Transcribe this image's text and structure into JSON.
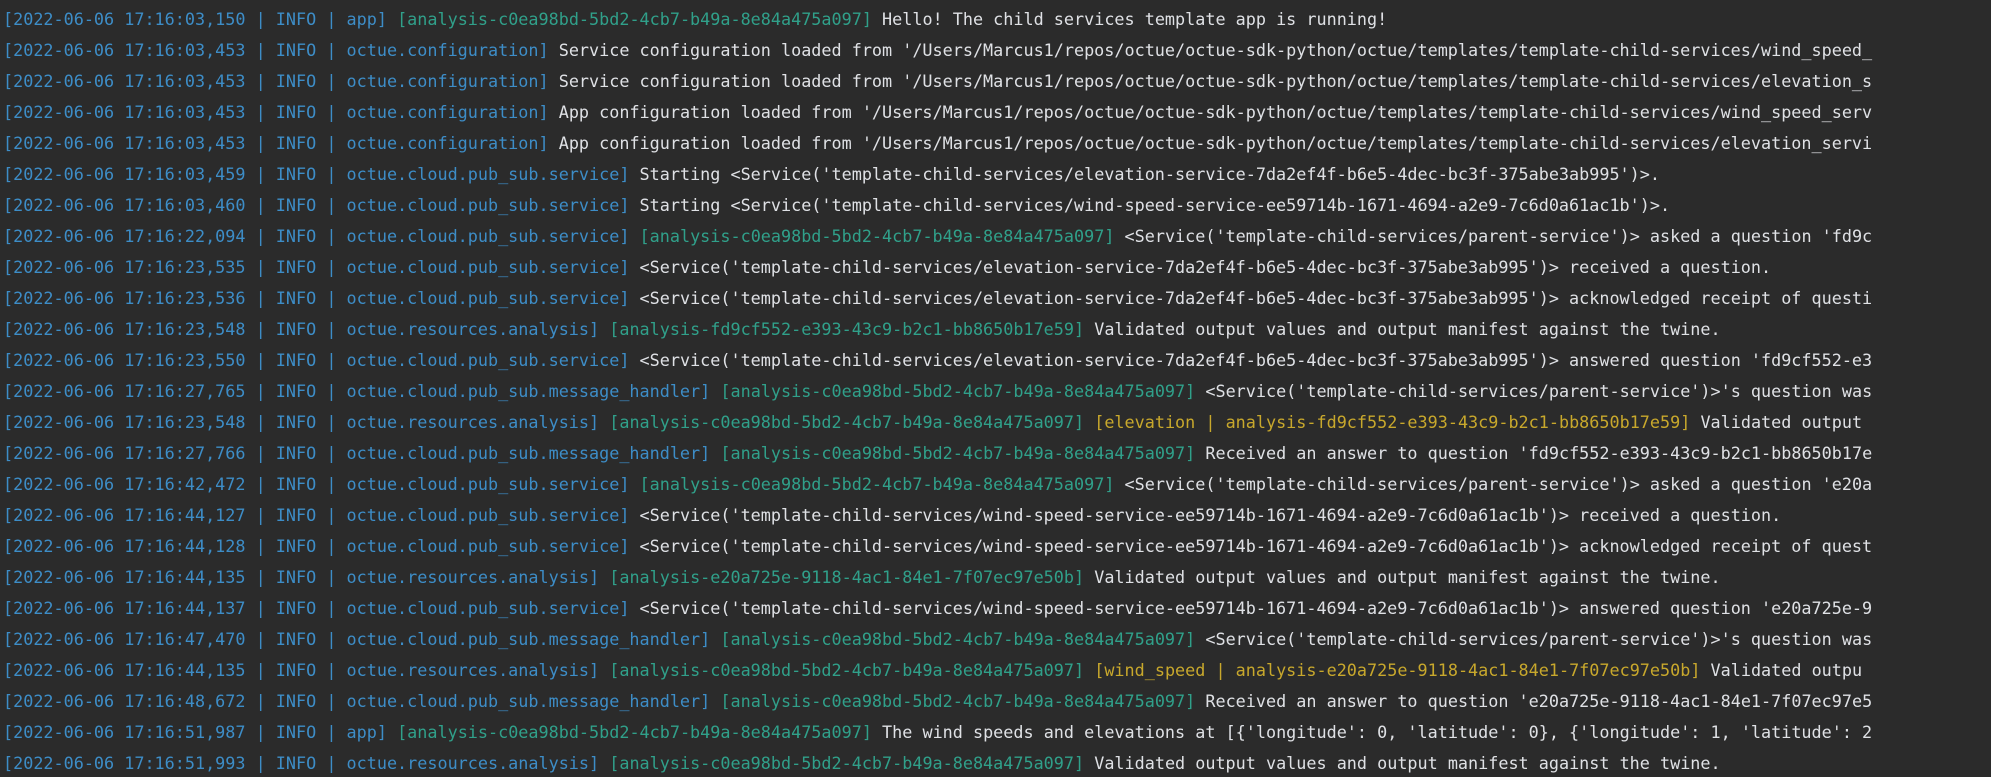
{
  "colors": {
    "background": "#2b2b2b",
    "timestamp_level_logger": "#3d8dc7",
    "analysis_tag": "#30a08a",
    "child_tag": "#c8a82c",
    "message": "#dfe1e5"
  },
  "lines": [
    {
      "ts": "2022-06-06 17:16:03,150",
      "level": "INFO",
      "logger": "app",
      "analysis": "analysis-c0ea98bd-5bd2-4cb7-b49a-8e84a475a097",
      "child": "",
      "message": "Hello! The child services template app is running!"
    },
    {
      "ts": "2022-06-06 17:16:03,453",
      "level": "INFO",
      "logger": "octue.configuration",
      "analysis": "",
      "child": "",
      "message": "Service configuration loaded from '/Users/Marcus1/repos/octue/octue-sdk-python/octue/templates/template-child-services/wind_speed_"
    },
    {
      "ts": "2022-06-06 17:16:03,453",
      "level": "INFO",
      "logger": "octue.configuration",
      "analysis": "",
      "child": "",
      "message": "Service configuration loaded from '/Users/Marcus1/repos/octue/octue-sdk-python/octue/templates/template-child-services/elevation_s"
    },
    {
      "ts": "2022-06-06 17:16:03,453",
      "level": "INFO",
      "logger": "octue.configuration",
      "analysis": "",
      "child": "",
      "message": "App configuration loaded from '/Users/Marcus1/repos/octue/octue-sdk-python/octue/templates/template-child-services/wind_speed_serv"
    },
    {
      "ts": "2022-06-06 17:16:03,453",
      "level": "INFO",
      "logger": "octue.configuration",
      "analysis": "",
      "child": "",
      "message": "App configuration loaded from '/Users/Marcus1/repos/octue/octue-sdk-python/octue/templates/template-child-services/elevation_servi"
    },
    {
      "ts": "2022-06-06 17:16:03,459",
      "level": "INFO",
      "logger": "octue.cloud.pub_sub.service",
      "analysis": "",
      "child": "",
      "message": "Starting <Service('template-child-services/elevation-service-7da2ef4f-b6e5-4dec-bc3f-375abe3ab995')>."
    },
    {
      "ts": "2022-06-06 17:16:03,460",
      "level": "INFO",
      "logger": "octue.cloud.pub_sub.service",
      "analysis": "",
      "child": "",
      "message": "Starting <Service('template-child-services/wind-speed-service-ee59714b-1671-4694-a2e9-7c6d0a61ac1b')>."
    },
    {
      "ts": "2022-06-06 17:16:22,094",
      "level": "INFO",
      "logger": "octue.cloud.pub_sub.service",
      "analysis": "analysis-c0ea98bd-5bd2-4cb7-b49a-8e84a475a097",
      "child": "",
      "message": "<Service('template-child-services/parent-service')> asked a question 'fd9c"
    },
    {
      "ts": "2022-06-06 17:16:23,535",
      "level": "INFO",
      "logger": "octue.cloud.pub_sub.service",
      "analysis": "",
      "child": "",
      "message": "<Service('template-child-services/elevation-service-7da2ef4f-b6e5-4dec-bc3f-375abe3ab995')> received a question."
    },
    {
      "ts": "2022-06-06 17:16:23,536",
      "level": "INFO",
      "logger": "octue.cloud.pub_sub.service",
      "analysis": "",
      "child": "",
      "message": "<Service('template-child-services/elevation-service-7da2ef4f-b6e5-4dec-bc3f-375abe3ab995')> acknowledged receipt of questi"
    },
    {
      "ts": "2022-06-06 17:16:23,548",
      "level": "INFO",
      "logger": "octue.resources.analysis",
      "analysis": "analysis-fd9cf552-e393-43c9-b2c1-bb8650b17e59",
      "child": "",
      "message": "Validated output values and output manifest against the twine."
    },
    {
      "ts": "2022-06-06 17:16:23,550",
      "level": "INFO",
      "logger": "octue.cloud.pub_sub.service",
      "analysis": "",
      "child": "",
      "message": "<Service('template-child-services/elevation-service-7da2ef4f-b6e5-4dec-bc3f-375abe3ab995')> answered question 'fd9cf552-e3"
    },
    {
      "ts": "2022-06-06 17:16:27,765",
      "level": "INFO",
      "logger": "octue.cloud.pub_sub.message_handler",
      "analysis": "analysis-c0ea98bd-5bd2-4cb7-b49a-8e84a475a097",
      "child": "",
      "message": "<Service('template-child-services/parent-service')>'s question was"
    },
    {
      "ts": "2022-06-06 17:16:23,548",
      "level": "INFO",
      "logger": "octue.resources.analysis",
      "analysis": "analysis-c0ea98bd-5bd2-4cb7-b49a-8e84a475a097",
      "child": "elevation | analysis-fd9cf552-e393-43c9-b2c1-bb8650b17e59",
      "message": "Validated output"
    },
    {
      "ts": "2022-06-06 17:16:27,766",
      "level": "INFO",
      "logger": "octue.cloud.pub_sub.message_handler",
      "analysis": "analysis-c0ea98bd-5bd2-4cb7-b49a-8e84a475a097",
      "child": "",
      "message": "Received an answer to question 'fd9cf552-e393-43c9-b2c1-bb8650b17e"
    },
    {
      "ts": "2022-06-06 17:16:42,472",
      "level": "INFO",
      "logger": "octue.cloud.pub_sub.service",
      "analysis": "analysis-c0ea98bd-5bd2-4cb7-b49a-8e84a475a097",
      "child": "",
      "message": "<Service('template-child-services/parent-service')> asked a question 'e20a"
    },
    {
      "ts": "2022-06-06 17:16:44,127",
      "level": "INFO",
      "logger": "octue.cloud.pub_sub.service",
      "analysis": "",
      "child": "",
      "message": "<Service('template-child-services/wind-speed-service-ee59714b-1671-4694-a2e9-7c6d0a61ac1b')> received a question."
    },
    {
      "ts": "2022-06-06 17:16:44,128",
      "level": "INFO",
      "logger": "octue.cloud.pub_sub.service",
      "analysis": "",
      "child": "",
      "message": "<Service('template-child-services/wind-speed-service-ee59714b-1671-4694-a2e9-7c6d0a61ac1b')> acknowledged receipt of quest"
    },
    {
      "ts": "2022-06-06 17:16:44,135",
      "level": "INFO",
      "logger": "octue.resources.analysis",
      "analysis": "analysis-e20a725e-9118-4ac1-84e1-7f07ec97e50b",
      "child": "",
      "message": "Validated output values and output manifest against the twine."
    },
    {
      "ts": "2022-06-06 17:16:44,137",
      "level": "INFO",
      "logger": "octue.cloud.pub_sub.service",
      "analysis": "",
      "child": "",
      "message": "<Service('template-child-services/wind-speed-service-ee59714b-1671-4694-a2e9-7c6d0a61ac1b')> answered question 'e20a725e-9"
    },
    {
      "ts": "2022-06-06 17:16:47,470",
      "level": "INFO",
      "logger": "octue.cloud.pub_sub.message_handler",
      "analysis": "analysis-c0ea98bd-5bd2-4cb7-b49a-8e84a475a097",
      "child": "",
      "message": "<Service('template-child-services/parent-service')>'s question was"
    },
    {
      "ts": "2022-06-06 17:16:44,135",
      "level": "INFO",
      "logger": "octue.resources.analysis",
      "analysis": "analysis-c0ea98bd-5bd2-4cb7-b49a-8e84a475a097",
      "child": "wind_speed | analysis-e20a725e-9118-4ac1-84e1-7f07ec97e50b",
      "message": "Validated outpu"
    },
    {
      "ts": "2022-06-06 17:16:48,672",
      "level": "INFO",
      "logger": "octue.cloud.pub_sub.message_handler",
      "analysis": "analysis-c0ea98bd-5bd2-4cb7-b49a-8e84a475a097",
      "child": "",
      "message": "Received an answer to question 'e20a725e-9118-4ac1-84e1-7f07ec97e5"
    },
    {
      "ts": "2022-06-06 17:16:51,987",
      "level": "INFO",
      "logger": "app",
      "analysis": "analysis-c0ea98bd-5bd2-4cb7-b49a-8e84a475a097",
      "child": "",
      "message": "The wind speeds and elevations at [{'longitude': 0, 'latitude': 0}, {'longitude': 1, 'latitude': 2"
    },
    {
      "ts": "2022-06-06 17:16:51,993",
      "level": "INFO",
      "logger": "octue.resources.analysis",
      "analysis": "analysis-c0ea98bd-5bd2-4cb7-b49a-8e84a475a097",
      "child": "",
      "message": "Validated output values and output manifest against the twine."
    }
  ]
}
